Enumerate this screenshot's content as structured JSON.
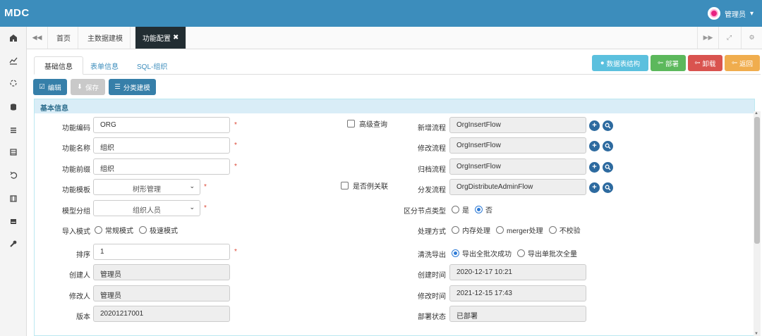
{
  "app": {
    "logo": "MDC",
    "user": "管理员"
  },
  "sidebar": {
    "icons": [
      "home-icon",
      "chart-icon",
      "circle-icon",
      "database-icon",
      "list-icon",
      "table-icon",
      "undo-icon",
      "film-icon",
      "drive-icon",
      "wrench-icon"
    ]
  },
  "tabbar": {
    "nav_back": "◀◀",
    "tabs": [
      {
        "label": "首页"
      },
      {
        "label": "主数据建模"
      },
      {
        "label": "功能配置",
        "close": "✖"
      }
    ],
    "nav_fwd": "▶▶",
    "expand": "⤢",
    "settings": "⚙"
  },
  "subtabs": [
    "基础信息",
    "表单信息",
    "SQL-组织"
  ],
  "header_buttons": {
    "table_structure": "数据表结构",
    "deploy": "部署",
    "unload": "卸载",
    "back": "返回"
  },
  "actions": {
    "edit": "编辑",
    "save": "保存",
    "categorize": "分类建模"
  },
  "panel": {
    "title": "基本信息"
  },
  "form": {
    "code": {
      "label": "功能编码",
      "value": "ORG"
    },
    "name": {
      "label": "功能名称",
      "value": "组织"
    },
    "prefix": {
      "label": "功能前缀",
      "value": "组织"
    },
    "template": {
      "label": "功能模板",
      "value": "树形管理"
    },
    "model_group": {
      "label": "模型分组",
      "value": "组织人员"
    },
    "import_mode": {
      "label": "导入模式",
      "options": [
        "常规模式",
        "极速模式"
      ]
    },
    "order": {
      "label": "排序",
      "value": "1"
    },
    "creator": {
      "label": "创建人",
      "value": "管理员"
    },
    "modifier": {
      "label": "修改人",
      "value": "管理员"
    },
    "version": {
      "label": "版本",
      "value": "20201217001"
    },
    "advanced_query": "高级查询",
    "instance_assoc": "是否例关联",
    "add_flow": {
      "label": "新增流程",
      "value": "OrgInsertFlow"
    },
    "modify_flow": {
      "label": "修改流程",
      "value": "OrgInsertFlow"
    },
    "archive_flow": {
      "label": "归档流程",
      "value": "OrgInsertFlow"
    },
    "dispatch_flow": {
      "label": "分发流程",
      "value": "OrgDistributeAdminFlow"
    },
    "distinguish_node": {
      "label": "区分节点类型",
      "options": [
        "是",
        "否"
      ],
      "selected": "否"
    },
    "process_mode": {
      "label": "处理方式",
      "options": [
        "内存处理",
        "merger处理",
        "不校验"
      ]
    },
    "clean_export": {
      "label": "清洗导出",
      "options": [
        "导出全批次成功",
        "导出单批次全量"
      ],
      "selected": "导出全批次成功"
    },
    "create_time": {
      "label": "创建时间",
      "value": "2020-12-17 10:21"
    },
    "modify_time": {
      "label": "修改时间",
      "value": "2021-12-15 17:43"
    },
    "deploy_status": {
      "label": "部署状态",
      "value": "已部署"
    },
    "required_mark": "*"
  },
  "colors": {
    "header": "#3c8dbc",
    "info": "#5bc0de",
    "success": "#5cb85c",
    "danger": "#d9534f",
    "warning": "#f0ad4e",
    "primary": "#367fa9"
  }
}
